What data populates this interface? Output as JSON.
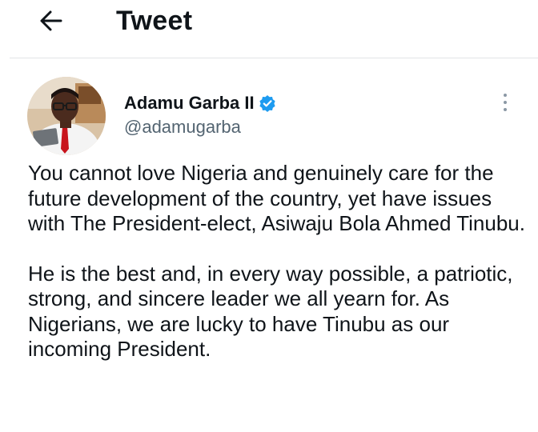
{
  "header": {
    "title": "Tweet",
    "back_icon": "arrow-left-icon"
  },
  "author": {
    "display_name": "Adamu Garba II",
    "handle": "@adamugarba",
    "verified": true,
    "verified_icon": "verified-badge-icon",
    "verified_color": "#1d9bf0"
  },
  "menu": {
    "icon": "more-vertical-icon"
  },
  "tweet": {
    "paragraphs": [
      "You cannot love Nigeria and genuinely care for the future development of the country, yet have issues with The President-elect, Asiwaju Bola Ahmed Tinubu.",
      "He is the best and, in every way possible, a patriotic, strong, and sincere leader we all yearn for. As Nigerians, we are lucky to have Tinubu as our incoming President."
    ]
  },
  "colors": {
    "text_primary": "#0f1419",
    "text_secondary": "#536471",
    "divider": "#e1e4e6",
    "background": "#ffffff"
  }
}
